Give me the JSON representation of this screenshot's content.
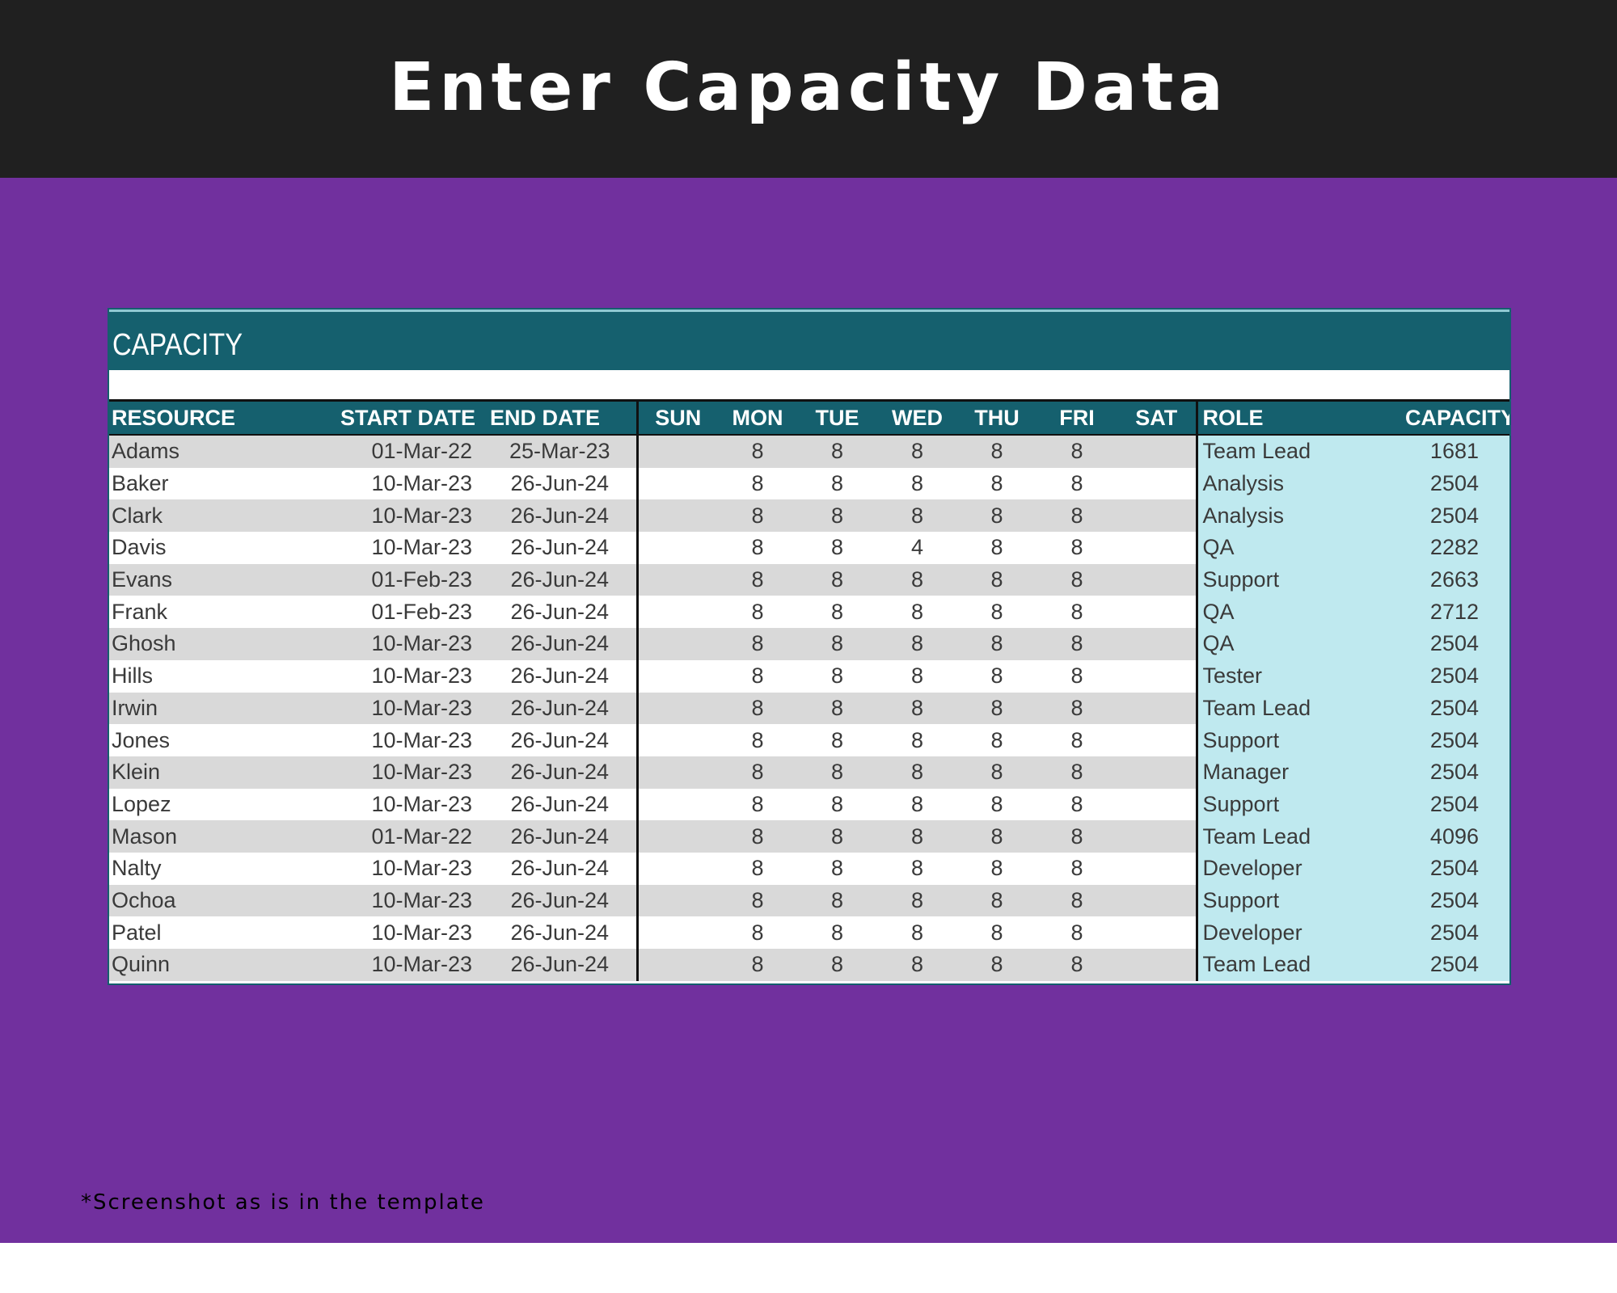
{
  "banner": {
    "title": "Enter Capacity Data"
  },
  "sheet": {
    "title": "CAPACITY",
    "headers": {
      "resource": "RESOURCE",
      "start_date": "START DATE",
      "end_date": "END DATE",
      "sun": "SUN",
      "mon": "MON",
      "tue": "TUE",
      "wed": "WED",
      "thu": "THU",
      "fri": "FRI",
      "sat": "SAT",
      "role": "ROLE",
      "capacity": "CAPACITY"
    },
    "rows": [
      {
        "resource": "Adams",
        "start": "01-Mar-22",
        "end": "25-Mar-23",
        "sun": "",
        "mon": "8",
        "tue": "8",
        "wed": "8",
        "thu": "8",
        "fri": "8",
        "sat": "",
        "role": "Team Lead",
        "capacity": "1681"
      },
      {
        "resource": "Baker",
        "start": "10-Mar-23",
        "end": "26-Jun-24",
        "sun": "",
        "mon": "8",
        "tue": "8",
        "wed": "8",
        "thu": "8",
        "fri": "8",
        "sat": "",
        "role": "Analysis",
        "capacity": "2504"
      },
      {
        "resource": "Clark",
        "start": "10-Mar-23",
        "end": "26-Jun-24",
        "sun": "",
        "mon": "8",
        "tue": "8",
        "wed": "8",
        "thu": "8",
        "fri": "8",
        "sat": "",
        "role": "Analysis",
        "capacity": "2504"
      },
      {
        "resource": "Davis",
        "start": "10-Mar-23",
        "end": "26-Jun-24",
        "sun": "",
        "mon": "8",
        "tue": "8",
        "wed": "4",
        "thu": "8",
        "fri": "8",
        "sat": "",
        "role": "QA",
        "capacity": "2282"
      },
      {
        "resource": "Evans",
        "start": "01-Feb-23",
        "end": "26-Jun-24",
        "sun": "",
        "mon": "8",
        "tue": "8",
        "wed": "8",
        "thu": "8",
        "fri": "8",
        "sat": "",
        "role": "Support",
        "capacity": "2663"
      },
      {
        "resource": "Frank",
        "start": "01-Feb-23",
        "end": "26-Jun-24",
        "sun": "",
        "mon": "8",
        "tue": "8",
        "wed": "8",
        "thu": "8",
        "fri": "8",
        "sat": "",
        "role": "QA",
        "capacity": "2712"
      },
      {
        "resource": "Ghosh",
        "start": "10-Mar-23",
        "end": "26-Jun-24",
        "sun": "",
        "mon": "8",
        "tue": "8",
        "wed": "8",
        "thu": "8",
        "fri": "8",
        "sat": "",
        "role": "QA",
        "capacity": "2504"
      },
      {
        "resource": "Hills",
        "start": "10-Mar-23",
        "end": "26-Jun-24",
        "sun": "",
        "mon": "8",
        "tue": "8",
        "wed": "8",
        "thu": "8",
        "fri": "8",
        "sat": "",
        "role": "Tester",
        "capacity": "2504"
      },
      {
        "resource": "Irwin",
        "start": "10-Mar-23",
        "end": "26-Jun-24",
        "sun": "",
        "mon": "8",
        "tue": "8",
        "wed": "8",
        "thu": "8",
        "fri": "8",
        "sat": "",
        "role": "Team Lead",
        "capacity": "2504"
      },
      {
        "resource": "Jones",
        "start": "10-Mar-23",
        "end": "26-Jun-24",
        "sun": "",
        "mon": "8",
        "tue": "8",
        "wed": "8",
        "thu": "8",
        "fri": "8",
        "sat": "",
        "role": "Support",
        "capacity": "2504"
      },
      {
        "resource": "Klein",
        "start": "10-Mar-23",
        "end": "26-Jun-24",
        "sun": "",
        "mon": "8",
        "tue": "8",
        "wed": "8",
        "thu": "8",
        "fri": "8",
        "sat": "",
        "role": "Manager",
        "capacity": "2504"
      },
      {
        "resource": "Lopez",
        "start": "10-Mar-23",
        "end": "26-Jun-24",
        "sun": "",
        "mon": "8",
        "tue": "8",
        "wed": "8",
        "thu": "8",
        "fri": "8",
        "sat": "",
        "role": "Support",
        "capacity": "2504"
      },
      {
        "resource": "Mason",
        "start": "01-Mar-22",
        "end": "26-Jun-24",
        "sun": "",
        "mon": "8",
        "tue": "8",
        "wed": "8",
        "thu": "8",
        "fri": "8",
        "sat": "",
        "role": "Team Lead",
        "capacity": "4096"
      },
      {
        "resource": "Nalty",
        "start": "10-Mar-23",
        "end": "26-Jun-24",
        "sun": "",
        "mon": "8",
        "tue": "8",
        "wed": "8",
        "thu": "8",
        "fri": "8",
        "sat": "",
        "role": "Developer",
        "capacity": "2504"
      },
      {
        "resource": "Ochoa",
        "start": "10-Mar-23",
        "end": "26-Jun-24",
        "sun": "",
        "mon": "8",
        "tue": "8",
        "wed": "8",
        "thu": "8",
        "fri": "8",
        "sat": "",
        "role": "Support",
        "capacity": "2504"
      },
      {
        "resource": "Patel",
        "start": "10-Mar-23",
        "end": "26-Jun-24",
        "sun": "",
        "mon": "8",
        "tue": "8",
        "wed": "8",
        "thu": "8",
        "fri": "8",
        "sat": "",
        "role": "Developer",
        "capacity": "2504"
      },
      {
        "resource": "Quinn",
        "start": "10-Mar-23",
        "end": "26-Jun-24",
        "sun": "",
        "mon": "8",
        "tue": "8",
        "wed": "8",
        "thu": "8",
        "fri": "8",
        "sat": "",
        "role": "Team Lead",
        "capacity": "2504"
      }
    ]
  },
  "footnote": "*Screenshot as is in the template",
  "colors": {
    "banner_bg": "#202020",
    "panel_bg": "#71309e",
    "header_teal": "#15606e",
    "row_gray": "#d9d9d9",
    "role_cyan": "#bfe9ef"
  }
}
